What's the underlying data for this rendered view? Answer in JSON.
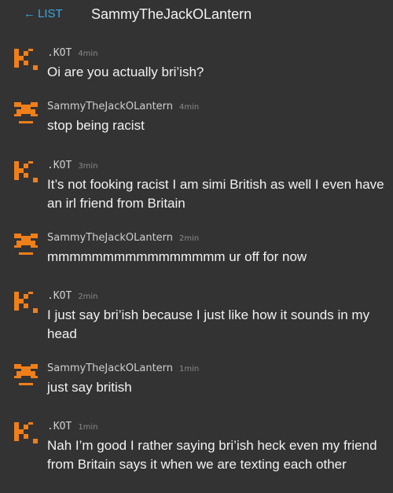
{
  "header": {
    "back_label": "LIST",
    "title": "SammyTheJackOLantern"
  },
  "colors": {
    "background": "#333333",
    "accent": "#3aa9e0",
    "avatar_orange": "#f07f1a"
  },
  "messages": [
    {
      "user": ".KOT",
      "avatar": "kot-avatar-icon",
      "time": "4min",
      "text": "Oi are you actually bri’ish?"
    },
    {
      "user": "SammyTheJackOLantern",
      "avatar": "pumpkin-avatar-icon",
      "time": "4min",
      "text": "stop being racist"
    },
    {
      "user": ".KOT",
      "avatar": "kot-avatar-icon",
      "time": "3min",
      "text": "It’s not fooking racist I am simi British as well I even have an irl friend from Britain"
    },
    {
      "user": "SammyTheJackOLantern",
      "avatar": "pumpkin-avatar-icon",
      "time": "2min",
      "text": "mmmmmmmmmmmmmmmm ur off for now"
    },
    {
      "user": ".KOT",
      "avatar": "kot-avatar-icon",
      "time": "2min",
      "text": "I just say bri’ish because I just like how it sounds in my head"
    },
    {
      "user": "SammyTheJackOLantern",
      "avatar": "pumpkin-avatar-icon",
      "time": "1min",
      "text": "just say british"
    },
    {
      "user": ".KOT",
      "avatar": "kot-avatar-icon",
      "time": "1min",
      "text": "Nah I’m good I rather saying bri’ish heck even my friend from Britain says it when we are texting each other"
    }
  ]
}
